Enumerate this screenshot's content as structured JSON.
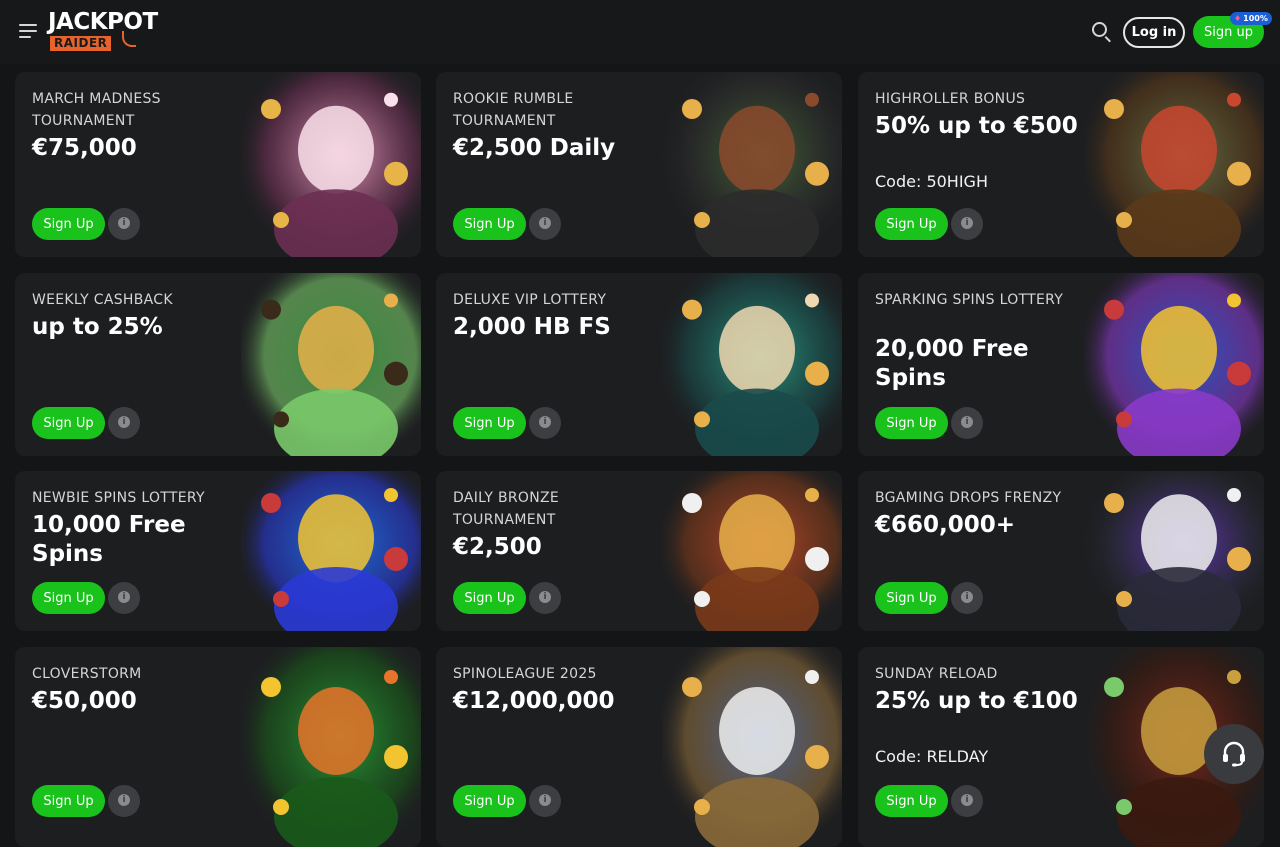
{
  "header": {
    "logo_top": "JACKPOT",
    "logo_bottom": "RAIDER",
    "login_label": "Log in",
    "signup_label": "Sign up",
    "signup_badge": "100%"
  },
  "cards": [
    {
      "title": "MARCH MADNESS TOURNAMENT",
      "value": "€75,000",
      "code": "",
      "cta": "Sign Up",
      "art": "elf-girl-art"
    },
    {
      "title": "ROOKIE RUMBLE TOURNAMENT",
      "value": "€2,500 Daily",
      "code": "",
      "cta": "Sign Up",
      "art": "explorer-art"
    },
    {
      "title": "HIGHROLLER BONUS",
      "value": "50% up to €500",
      "code": "Code: 50HIGH",
      "cta": "Sign Up",
      "art": "treasure-woman-art"
    },
    {
      "title": "WEEKLY CASHBACK",
      "value": "up to 25%",
      "code": "",
      "cta": "Sign Up",
      "art": "cashback-art"
    },
    {
      "title": "DELUXE VIP LOTTERY",
      "value": "2,000 HB FS",
      "code": "",
      "cta": "Sign Up",
      "art": "vip-queen-art"
    },
    {
      "title": "SPARKING SPINS LOTTERY",
      "value": "20,000 Free Spins",
      "code": "",
      "cta": "Sign Up",
      "art": "lightning-coin-art"
    },
    {
      "title": "NEWBIE SPINS LOTTERY",
      "value": "10,000 Free Spins",
      "code": "",
      "cta": "Sign Up",
      "art": "lightning-fruit-art"
    },
    {
      "title": "DAILY BRONZE TOURNAMENT",
      "value": "€2,500",
      "code": "",
      "cta": "Sign Up",
      "art": "goddess-art"
    },
    {
      "title": "BGAMING DROPS FRENZY",
      "value": "€660,000+",
      "code": "",
      "cta": "Sign Up",
      "art": "rabbit-art"
    },
    {
      "title": "CLOVERSTORM",
      "value": "€50,000",
      "code": "",
      "cta": "Sign Up",
      "art": "leprechaun-art"
    },
    {
      "title": "SPINOLEAGUE 2025",
      "value": "€12,000,000",
      "code": "",
      "cta": "Sign Up",
      "art": "zeus-art"
    },
    {
      "title": "SUNDAY RELOAD",
      "value": "25% up to €100",
      "code": "Code: RELDAY",
      "cta": "Sign Up",
      "art": "trophy-art"
    }
  ],
  "icons": {
    "menu": "hamburger-menu-icon",
    "search": "search-icon",
    "info": "info-icon",
    "support": "headset-icon"
  },
  "colors": {
    "background": "#141516",
    "card": "#1d1e20",
    "accent_green": "#1ac21c",
    "logo_orange": "#e8632b"
  }
}
